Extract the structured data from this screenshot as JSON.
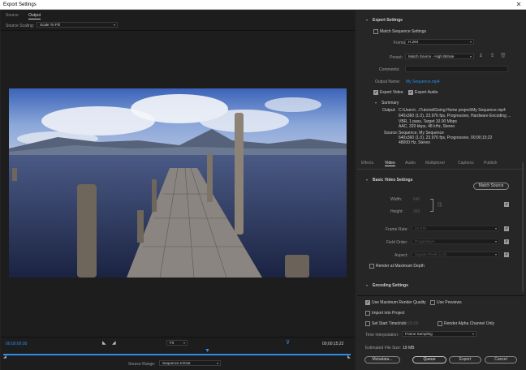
{
  "window": {
    "title": "Export Settings"
  },
  "left": {
    "tabs": {
      "source": "Source",
      "output": "Output"
    },
    "source_scaling_label": "Source Scaling:",
    "source_scaling_value": "Scale To Fill",
    "timecode_in": "00;00;00;00",
    "timecode_out": "00;00;15;22",
    "zoom": "Fit",
    "source_range_label": "Source Range:",
    "source_range_value": "Sequence In/Out"
  },
  "export": {
    "heading": "Export Settings",
    "match_sequence": "Match Sequence Settings",
    "format_label": "Format:",
    "format_value": "H.264",
    "preset_label": "Preset:",
    "preset_value": "Match Source - High Bitrate",
    "comments_label": "Comments:",
    "output_name_label": "Output Name:",
    "output_name_value": "My Sequence.mp4",
    "export_video": "Export Video",
    "export_audio": "Export Audio"
  },
  "summary": {
    "heading": "Summary",
    "output_label": "Output:",
    "output_lines": [
      "C:\\Users\\...\\Tutorial\\Going Home project\\My Sequence.mp4",
      "640x360 (1.0), 23.976 fps, Progressive, Hardware Encoding ...",
      "VBR, 1 pass, Target 10.00 Mbps",
      "AAC, 320 kbps, 48 kHz, Stereo"
    ],
    "source_label": "Source:",
    "source_lines": [
      "Sequence, My Sequence",
      "640x360 (1.0), 23.976 fps, Progressive, 00;00;15;22",
      "48000 Hz, Stereo"
    ]
  },
  "settings_tabs": [
    "Effects",
    "Video",
    "Audio",
    "Multiplexer",
    "Captions",
    "Publish"
  ],
  "video": {
    "heading": "Basic Video Settings",
    "match_source": "Match Source",
    "width_label": "Width:",
    "width_value": "640",
    "height_label": "Height:",
    "height_value": "360",
    "frame_rate_label": "Frame Rate:",
    "frame_rate_value": "23.976",
    "field_order_label": "Field Order:",
    "field_order_value": "Progressive",
    "aspect_label": "Aspect:",
    "aspect_value": "Square Pixels (1.0)",
    "render_max_depth": "Render at Maximum Depth",
    "encoding_heading": "Encoding Settings"
  },
  "bottom": {
    "max_render_quality": "Use Maximum Render Quality",
    "use_previews": "Use Previews",
    "import_into_project": "Import into Project",
    "set_start_timecode": "Set Start Timecode",
    "start_timecode_value": "00;00;00;00",
    "render_alpha": "Render Alpha Channel Only",
    "time_interp_label": "Time Interpolation:",
    "time_interp_value": "Frame Sampling",
    "file_size_label": "Estimated File Size:",
    "file_size_value": "19 MB",
    "metadata_btn": "Metadata...",
    "queue_btn": "Queue",
    "export_btn": "Export",
    "cancel_btn": "Cancel"
  },
  "colors": {
    "accent_blue": "#2d8ceb",
    "panel_bg": "#1d1d1d",
    "right_bg": "#262626"
  }
}
